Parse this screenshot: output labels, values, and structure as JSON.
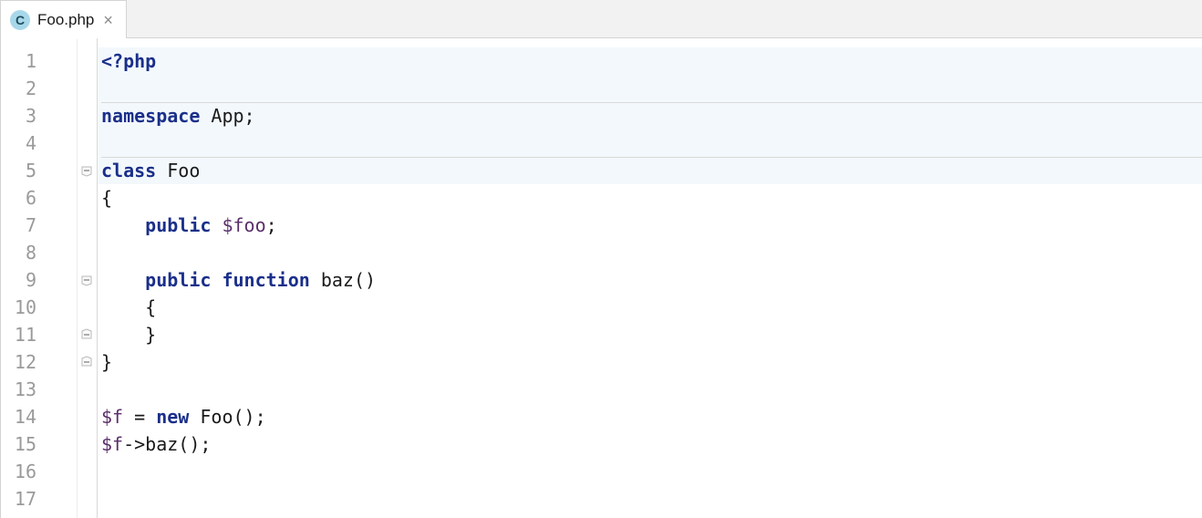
{
  "tab": {
    "icon_letter": "C",
    "filename": "Foo.php",
    "close_glyph": "×"
  },
  "editor": {
    "line_count": 17,
    "fold_markers": [
      {
        "line": 5,
        "type": "open"
      },
      {
        "line": 9,
        "type": "open"
      },
      {
        "line": 11,
        "type": "close"
      },
      {
        "line": 12,
        "type": "close"
      }
    ],
    "separators_after_line": [
      2,
      4
    ],
    "highlighted_lines": [
      1,
      2,
      3,
      4,
      5
    ],
    "code": {
      "l1": [
        {
          "cls": "kw",
          "t": "<?php"
        }
      ],
      "l2": [
        {
          "cls": "txt",
          "t": ""
        }
      ],
      "l3": [
        {
          "cls": "kw",
          "t": "namespace"
        },
        {
          "cls": "txt",
          "t": " App;"
        }
      ],
      "l4": [
        {
          "cls": "txt",
          "t": ""
        }
      ],
      "l5": [
        {
          "cls": "kw",
          "t": "class"
        },
        {
          "cls": "txt",
          "t": " Foo"
        }
      ],
      "l6": [
        {
          "cls": "txt",
          "t": "{"
        }
      ],
      "l7": [
        {
          "cls": "txt",
          "t": "    "
        },
        {
          "cls": "kw",
          "t": "public"
        },
        {
          "cls": "txt",
          "t": " "
        },
        {
          "cls": "var",
          "t": "$foo"
        },
        {
          "cls": "txt",
          "t": ";"
        }
      ],
      "l8": [
        {
          "cls": "txt",
          "t": ""
        }
      ],
      "l9": [
        {
          "cls": "txt",
          "t": "    "
        },
        {
          "cls": "kw",
          "t": "public"
        },
        {
          "cls": "txt",
          "t": " "
        },
        {
          "cls": "kw",
          "t": "function"
        },
        {
          "cls": "txt",
          "t": " baz()"
        }
      ],
      "l10": [
        {
          "cls": "txt",
          "t": "    {"
        }
      ],
      "l11": [
        {
          "cls": "txt",
          "t": "    }"
        }
      ],
      "l12": [
        {
          "cls": "txt",
          "t": "}"
        }
      ],
      "l13": [
        {
          "cls": "txt",
          "t": ""
        }
      ],
      "l14": [
        {
          "cls": "var",
          "t": "$f"
        },
        {
          "cls": "txt",
          "t": " = "
        },
        {
          "cls": "kw",
          "t": "new"
        },
        {
          "cls": "txt",
          "t": " Foo();"
        }
      ],
      "l15": [
        {
          "cls": "var",
          "t": "$f"
        },
        {
          "cls": "txt",
          "t": "->baz();"
        }
      ],
      "l16": [
        {
          "cls": "txt",
          "t": ""
        }
      ],
      "l17": [
        {
          "cls": "txt",
          "t": ""
        }
      ]
    }
  }
}
